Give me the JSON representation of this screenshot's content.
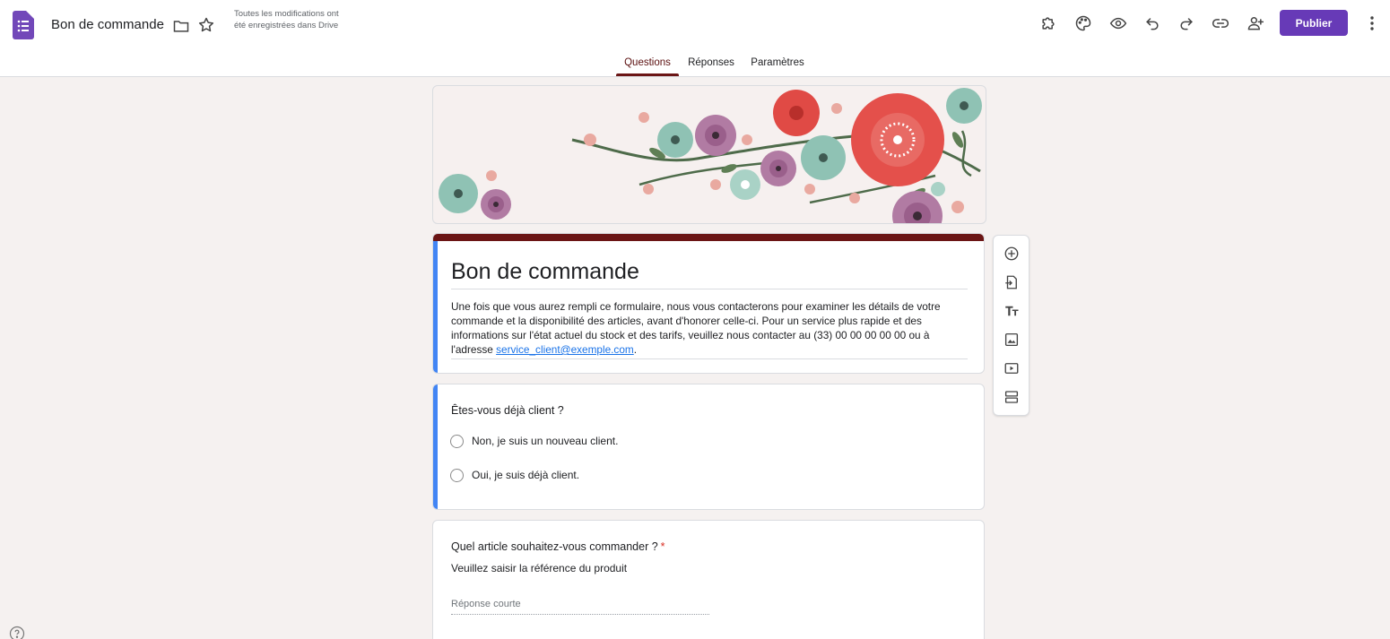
{
  "header": {
    "doc_title": "Bon de commande",
    "save_status": "Toutes les modifications ont été enregistrées dans Drive",
    "publish_label": "Publier",
    "icons": [
      "addons-icon",
      "palette-icon",
      "preview-icon",
      "undo-icon",
      "redo-icon",
      "link-icon",
      "add-collaborator-icon"
    ]
  },
  "tabs": [
    {
      "label": "Questions",
      "active": true
    },
    {
      "label": "Réponses",
      "active": false
    },
    {
      "label": "Paramètres",
      "active": false
    }
  ],
  "form": {
    "title": "Bon de commande",
    "description_text": "Une fois que vous aurez rempli ce formulaire, nous vous contacterons pour examiner les détails de votre commande et la disponibilité des articles, avant d'honorer celle-ci. Pour un service plus rapide et des informations sur l'état actuel du stock et des tarifs, veuillez nous contacter au (33) 00 00 00 00 00 ou à l'adresse",
    "description_link": "service_client@exemple.com",
    "description_end": "."
  },
  "questions": [
    {
      "title": "Êtes-vous déjà client ?",
      "options": [
        "Non, je suis un nouveau client.",
        "Oui, je suis déjà client."
      ]
    },
    {
      "title": "Quel article souhaitez-vous commander ?",
      "required_mark": "*",
      "description": "Veuillez saisir la référence du produit",
      "placeholder": "Réponse courte"
    }
  ],
  "theme": {
    "accent": "#6b1515",
    "active_card": "#4285f4",
    "publish_bg": "#673ab7",
    "background": "#f5f1f0"
  },
  "side_toolbar": [
    "add-question-icon",
    "import-questions-icon",
    "add-title-icon",
    "add-image-icon",
    "add-video-icon",
    "add-section-icon"
  ]
}
